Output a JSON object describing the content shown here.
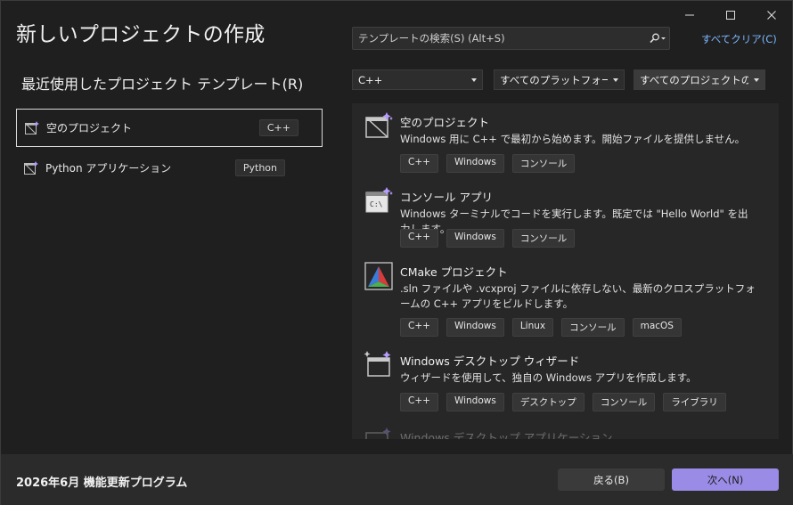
{
  "window": {
    "title": "新しいプロジェクトの作成",
    "controls": [
      "minimize-icon",
      "maximize-icon",
      "close-icon"
    ]
  },
  "search": {
    "placeholder": "テンプレートの検索(S) (Alt+S)",
    "clear_all": "すべてクリア(C)"
  },
  "recent": {
    "heading": "最近使用したプロジェクト テンプレート(R)",
    "items": [
      {
        "label": "空のプロジェクト",
        "tag": "C++",
        "selected": true,
        "icon": "empty-project-icon"
      },
      {
        "label": "Python アプリケーション",
        "tag": "Python",
        "selected": false,
        "icon": "python-app-icon"
      }
    ]
  },
  "filters": {
    "language": "C++",
    "platform": "すべてのプラットフォーム(P)",
    "project_type": "すべてのプロジェクトの..."
  },
  "templates": [
    {
      "name": "空のプロジェクト",
      "desc": "Windows 用に C++ で最初から始めます。開始ファイルを提供しません。",
      "tags": [
        "C++",
        "Windows",
        "コンソール"
      ],
      "icon": "empty-project-icon"
    },
    {
      "name": "コンソール アプリ",
      "desc": "Windows ターミナルでコードを実行します。既定では \"Hello World\" を出力します。",
      "tags": [
        "C++",
        "Windows",
        "コンソール"
      ],
      "icon": "console-app-icon"
    },
    {
      "name": "CMake プロジェクト",
      "desc": ".sln ファイルや .vcxproj ファイルに依存しない、最新のクロスプラットフォームの C++ アプリをビルドします。",
      "tags": [
        "C++",
        "Windows",
        "Linux",
        "コンソール",
        "macOS"
      ],
      "icon": "cmake-icon"
    },
    {
      "name": "Windows デスクトップ ウィザード",
      "desc": "ウィザードを使用して、独自の Windows アプリを作成します。",
      "tags": [
        "C++",
        "Windows",
        "デスクトップ",
        "コンソール",
        "ライブラリ"
      ],
      "icon": "desktop-wizard-icon"
    },
    {
      "name": "Windows デスクトップ アプリケーション",
      "desc": "",
      "tags": [],
      "icon": "desktop-app-icon"
    }
  ],
  "footer": {
    "note": "2026年6月 機能更新プログラム",
    "back": "戻る(B)",
    "next": "次へ(N)"
  },
  "colors": {
    "accent": "#9a8ce6",
    "link": "#7cb7ff",
    "background": "#1f1f1f"
  }
}
